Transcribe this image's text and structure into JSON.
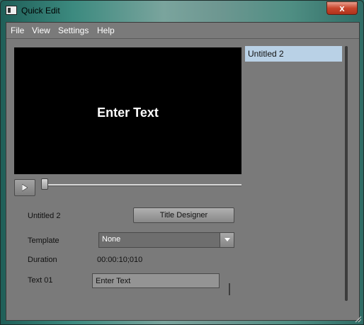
{
  "window": {
    "title": "Quick Edit",
    "close_label": "x"
  },
  "menu": {
    "items": [
      "File",
      "View",
      "Settings",
      "Help"
    ]
  },
  "preview": {
    "text": "Enter Text"
  },
  "playback": {
    "position_fraction": 0.0
  },
  "form": {
    "title_name": "Untitled 2",
    "title_designer_button": "Title Designer",
    "template_label": "Template",
    "template_value": "None",
    "duration_label": "Duration",
    "duration_value": "00:00:10;010",
    "text_label": "Text 01",
    "text_value": "Enter Text"
  },
  "title_list": {
    "items": [
      "Untitled 2"
    ],
    "selected_index": 0
  },
  "colors": {
    "selection": "#b9d1e6",
    "panel": "#7a7a7a",
    "close_button": "#c8462d"
  }
}
